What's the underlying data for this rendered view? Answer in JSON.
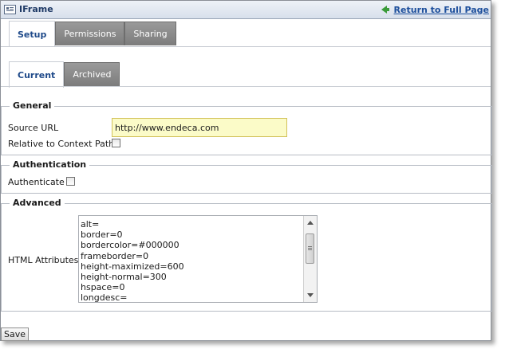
{
  "window": {
    "title": "IFrame",
    "return_link": "Return to Full Page"
  },
  "tabs": [
    {
      "label": "Setup",
      "active": true
    },
    {
      "label": "Permissions",
      "active": false
    },
    {
      "label": "Sharing",
      "active": false
    }
  ],
  "subtabs": [
    {
      "label": "Current",
      "active": true
    },
    {
      "label": "Archived",
      "active": false
    }
  ],
  "general": {
    "legend": "General",
    "source_url_label": "Source URL",
    "source_url_value": "http://www.endeca.com",
    "relative_label": "Relative to Context Path",
    "relative_checked": false
  },
  "authentication": {
    "legend": "Authentication",
    "authenticate_label": "Authenticate",
    "authenticate_checked": false
  },
  "advanced": {
    "legend": "Advanced",
    "html_attributes_label": "HTML Attributes",
    "html_attributes_value": "alt=\nborder=0\nbordercolor=#000000\nframeborder=0\nheight-maximized=600\nheight-normal=300\nhspace=0\nlongdesc="
  },
  "footer": {
    "save_label": "Save"
  },
  "colors": {
    "link": "#1d4f9c",
    "arrow": "#3a9b3a",
    "inactive_tab": "#7c7c7c",
    "input_highlight": "#fbfbc8"
  },
  "icons": {
    "app": "window-icon",
    "return": "arrow-left-icon"
  }
}
